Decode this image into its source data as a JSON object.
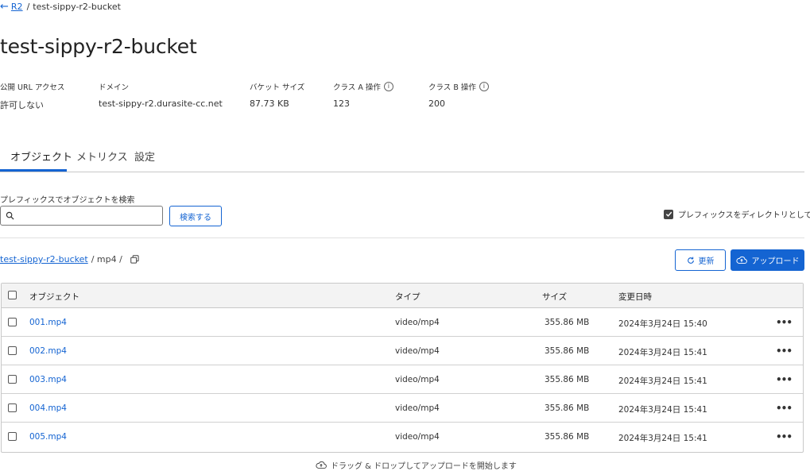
{
  "breadcrumb": {
    "back_label": "R2",
    "separator": "/",
    "current": "test-sippy-r2-bucket"
  },
  "page_title": "test-sippy-r2-bucket",
  "meta": [
    {
      "label": "公開 URL アクセス",
      "value": "許可しない",
      "info": false
    },
    {
      "label": "ドメイン",
      "value": "test-sippy-r2.durasite-cc.net",
      "info": false
    },
    {
      "label": "バケット サイズ",
      "value": "87.73 KB",
      "info": false
    },
    {
      "label": "クラス A 操作",
      "value": "123",
      "info": true
    },
    {
      "label": "クラス B 操作",
      "value": "200",
      "info": true
    }
  ],
  "tabs": [
    {
      "label": "オブジェクト",
      "active": true
    },
    {
      "label": "メトリクス",
      "active": false
    },
    {
      "label": "設定",
      "active": false
    }
  ],
  "search": {
    "label": "プレフィックスでオブジェクトを検索",
    "value": "",
    "button_label": "検索する"
  },
  "prefix_toggle": {
    "label": "プレフィックスをディレクトリとして表示",
    "checked": true
  },
  "path": {
    "bucket": "test-sippy-r2-bucket",
    "rest": "/ mp4 /"
  },
  "actions": {
    "refresh_label": "更新",
    "upload_label": "アップロード"
  },
  "table": {
    "headers": {
      "object": "オブジェクト",
      "type": "タイプ",
      "size": "サイズ",
      "modified": "変更日時"
    },
    "rows": [
      {
        "name": "001.mp4",
        "type": "video/mp4",
        "size": "355.86 MB",
        "modified": "2024年3月24日 15:40"
      },
      {
        "name": "002.mp4",
        "type": "video/mp4",
        "size": "355.86 MB",
        "modified": "2024年3月24日 15:41"
      },
      {
        "name": "003.mp4",
        "type": "video/mp4",
        "size": "355.86 MB",
        "modified": "2024年3月24日 15:41"
      },
      {
        "name": "004.mp4",
        "type": "video/mp4",
        "size": "355.86 MB",
        "modified": "2024年3月24日 15:41"
      },
      {
        "name": "005.mp4",
        "type": "video/mp4",
        "size": "355.86 MB",
        "modified": "2024年3月24日 15:41"
      }
    ]
  },
  "drop_hint": "ドラッグ & ドロップしてアップロードを開始します",
  "colors": {
    "accent": "#1464d2",
    "border": "#c8c8c8",
    "header_bg": "#f3f3f3"
  }
}
